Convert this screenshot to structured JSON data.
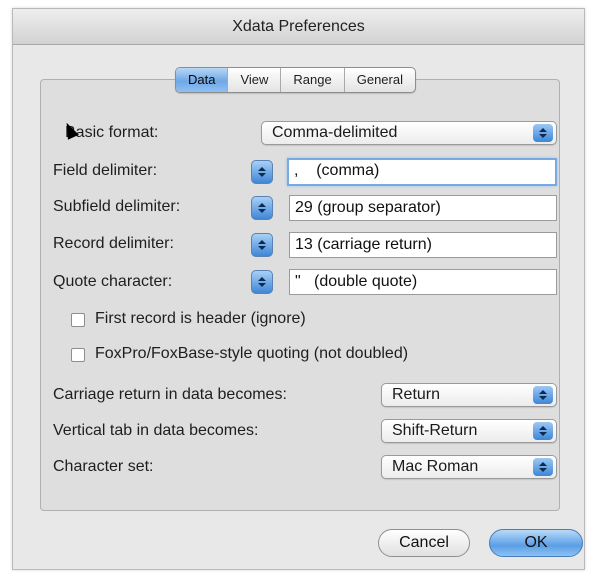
{
  "window": {
    "title": "Xdata Preferences"
  },
  "tabs": [
    {
      "label": "Data",
      "active": true
    },
    {
      "label": "View",
      "active": false
    },
    {
      "label": "Range",
      "active": false
    },
    {
      "label": "General",
      "active": false
    }
  ],
  "basic_format": {
    "label": "Basic format:",
    "value": "Comma-delimited"
  },
  "field_delimiter": {
    "label": "Field delimiter:",
    "value": ",    (comma)"
  },
  "subfield_delimiter": {
    "label": "Subfield delimiter:",
    "value": "29 (group separator)"
  },
  "record_delimiter": {
    "label": "Record delimiter:",
    "value": "13 (carriage return)"
  },
  "quote_character": {
    "label": "Quote character:",
    "value": "\"   (double quote)"
  },
  "checkboxes": {
    "first_record_header": {
      "label": "First record is header (ignore)",
      "checked": false
    },
    "foxpro_quoting": {
      "label": "FoxPro/FoxBase-style quoting (not doubled)",
      "checked": false
    }
  },
  "carriage_return": {
    "label": "Carriage return in data becomes:",
    "value": "Return"
  },
  "vertical_tab": {
    "label": "Vertical tab in data becomes:",
    "value": "Shift-Return"
  },
  "character_set": {
    "label": "Character set:",
    "value": "Mac Roman"
  },
  "buttons": {
    "cancel": "Cancel",
    "ok": "OK"
  },
  "colors": {
    "accent": "#5b9ee6",
    "focus_ring": "#79a9e3"
  },
  "icons": {
    "cursor": "arrow-cursor-icon",
    "stepper": "stepper-arrows-icon",
    "popup": "popup-arrows-icon"
  }
}
